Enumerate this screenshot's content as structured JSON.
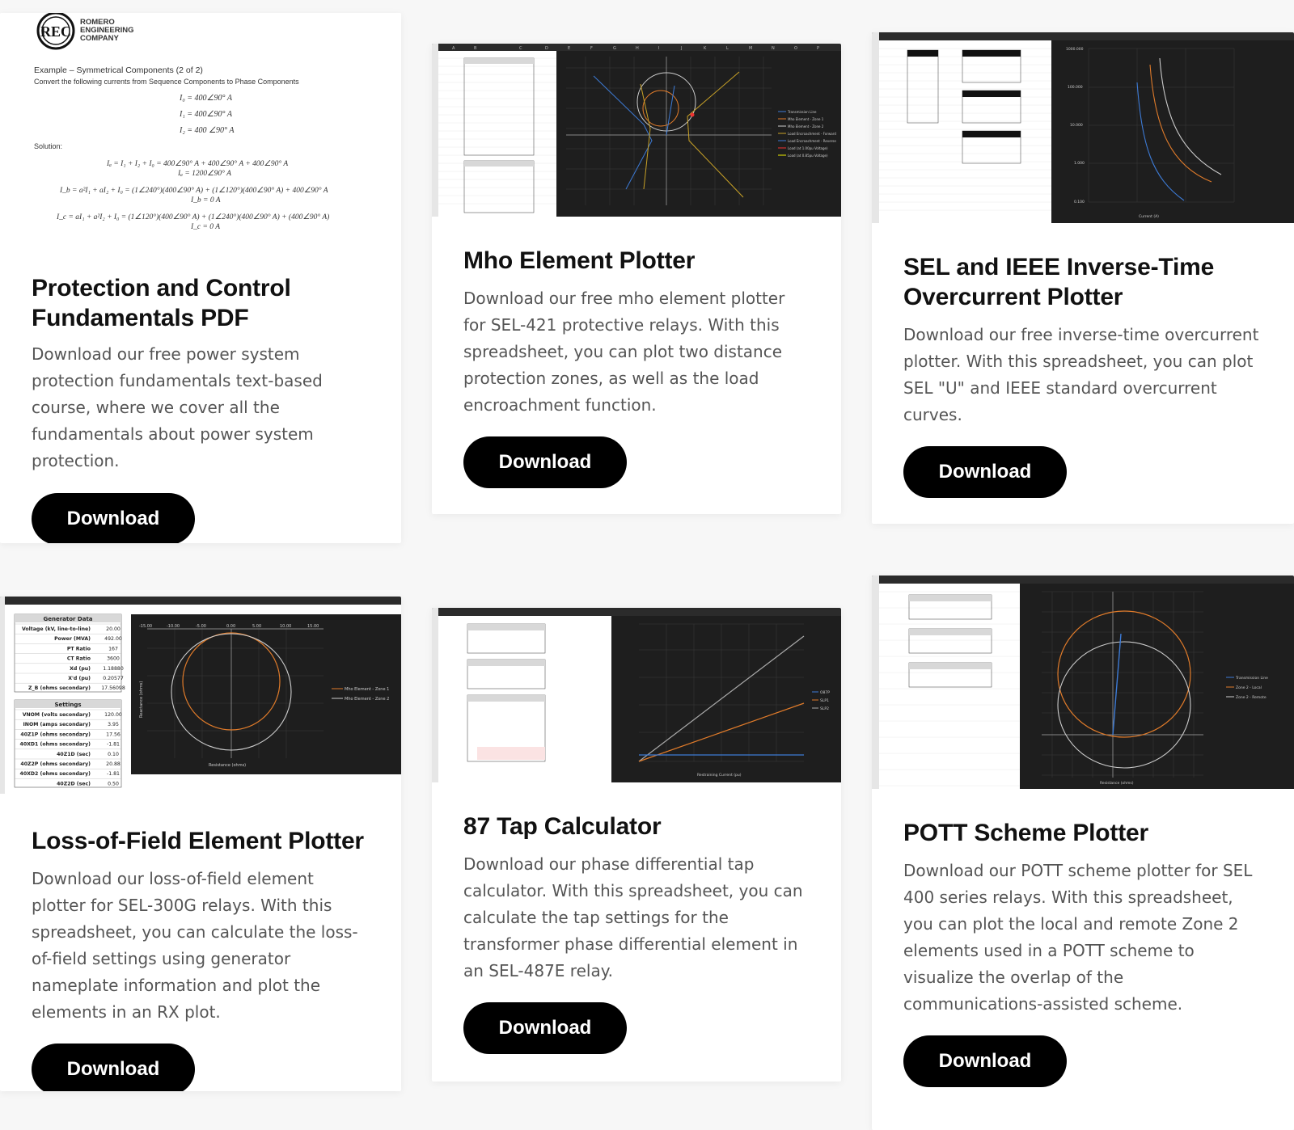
{
  "cards": [
    {
      "title": "Protection and Control Fundamentals PDF",
      "description": "Download our free power system protection fundamentals text-based course, where we cover all the fundamentals about power system protection.",
      "button": "Download",
      "thumb": {
        "logo_letters": "REC",
        "company_line1": "ROMERO",
        "company_line2": "ENGINEERING",
        "company_line3": "COMPANY",
        "heading": "Example – Symmetrical Components (2 of 2)",
        "subheading": "Convert the following currents from Sequence Components to Phase Components",
        "eq1": "I₀ = 400∠90° A",
        "eq2": "I₁ = 400∠90° A",
        "eq3": "I₂ = 400 ∠90° A",
        "solution": "Solution:",
        "eq4": "Iₐ = I₁ + I₂ + I₀ = 400∠90° A + 400∠90° A + 400∠90° A",
        "eq5": "Iₐ = 1200∠90° A",
        "eq6": "I_b = a²I₁ + aI₂ + I₀ = (1∠240°)(400∠90° A) + (1∠120°)(400∠90° A) + 400∠90° A",
        "eq7": "I_b = 0 A",
        "eq8": "I_c = aI₁ + a²I₂ + I₀ = (1∠120°)(400∠90° A) + (1∠240°)(400∠90° A) + (400∠90° A)",
        "eq9": "I_c = 0 A"
      }
    },
    {
      "title": "Mho Element Plotter",
      "description": "Download our free mho element plotter for SEL-421 protective relays. With this spreadsheet, you can plot two distance protection zones, as well as the load encroachment function.",
      "button": "Download"
    },
    {
      "title": "SEL and IEEE Inverse-Time Overcurrent Plotter",
      "description": "Download our free inverse-time overcurrent plotter. With this spreadsheet, you can plot SEL \"U\" and IEEE standard overcurrent curves.",
      "button": "Download"
    },
    {
      "title": "Loss-of-Field Element Plotter",
      "description": "Download our loss-of-field element plotter for SEL-300G relays. With this spreadsheet, you can calculate the loss-of-field settings using generator nameplate information and plot the elements in an RX plot.",
      "button": "Download",
      "thumb": {
        "table1_title": "Generator Data",
        "table1": [
          [
            "Voltage (kV, line-to-line)",
            "20.00"
          ],
          [
            "Power (MVA)",
            "492.00"
          ],
          [
            "PT Ratio",
            "167"
          ],
          [
            "CT Ratio",
            "3600"
          ],
          [
            "Xd (pu)",
            "1.18880"
          ],
          [
            "X'd (pu)",
            "0.20577"
          ],
          [
            "Z_B (ohms secondary)",
            "17.56098"
          ]
        ],
        "table2_title": "Settings",
        "table2": [
          [
            "VNOM (volts secondary)",
            "120.00"
          ],
          [
            "INOM (amps secondary)",
            "3.95"
          ],
          [
            "40Z1P (ohms secondary)",
            "17.56"
          ],
          [
            "40XD1 (ohms secondary)",
            "-1.81"
          ],
          [
            "40Z1D (sec)",
            "0.10"
          ],
          [
            "40Z2P (ohms secondary)",
            "20.88"
          ],
          [
            "40XD2 (ohms secondary)",
            "-1.81"
          ],
          [
            "40Z2D (sec)",
            "0.50"
          ]
        ],
        "legend1": "Mho Element - Zone 1",
        "legend2": "Mho Element - Zone 2",
        "xaxis": "Resistance (ohms)",
        "yaxis": "Reactance (ohms)"
      }
    },
    {
      "title": "87 Tap Calculator",
      "description": "Download our phase differential tap calculator. With this spreadsheet, you can calculate the tap settings for the transformer phase differential element in an SEL-487E relay.",
      "button": "Download"
    },
    {
      "title": "POTT Scheme Plotter",
      "description": "Download our POTT scheme plotter for SEL 400 series relays. With this spreadsheet, you can plot the local and remote Zone 2 elements used in a POTT scheme to visualize the overlap of the communications-assisted scheme.",
      "button": "Download"
    }
  ],
  "colors": {
    "button_bg": "#000000",
    "button_text": "#ffffff",
    "title": "#111111",
    "desc": "#555555",
    "chart_bg": "#1e1e1e",
    "orange": "#e07b2a",
    "blue": "#3d7bd6",
    "grey": "#bbbbbb"
  }
}
